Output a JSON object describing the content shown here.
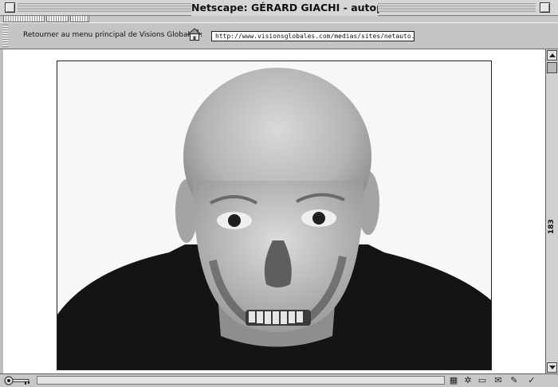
{
  "window": {
    "title": "Netscape: GÉRARD GIACHI - autoportrait.html"
  },
  "location_bar": {
    "back_label": "Retourner au menu principal de Visions Globales :",
    "home_icon": "house-icon",
    "url": "http://www.visionsglobales.com/medias/sites/netauto.html"
  },
  "scrollbar": {
    "counter": "183"
  },
  "content": {
    "image": "portrait-photo"
  },
  "status_icons": [
    "grid-icon",
    "component-icon",
    "folder-icon",
    "chat-icon",
    "pen-icon"
  ]
}
